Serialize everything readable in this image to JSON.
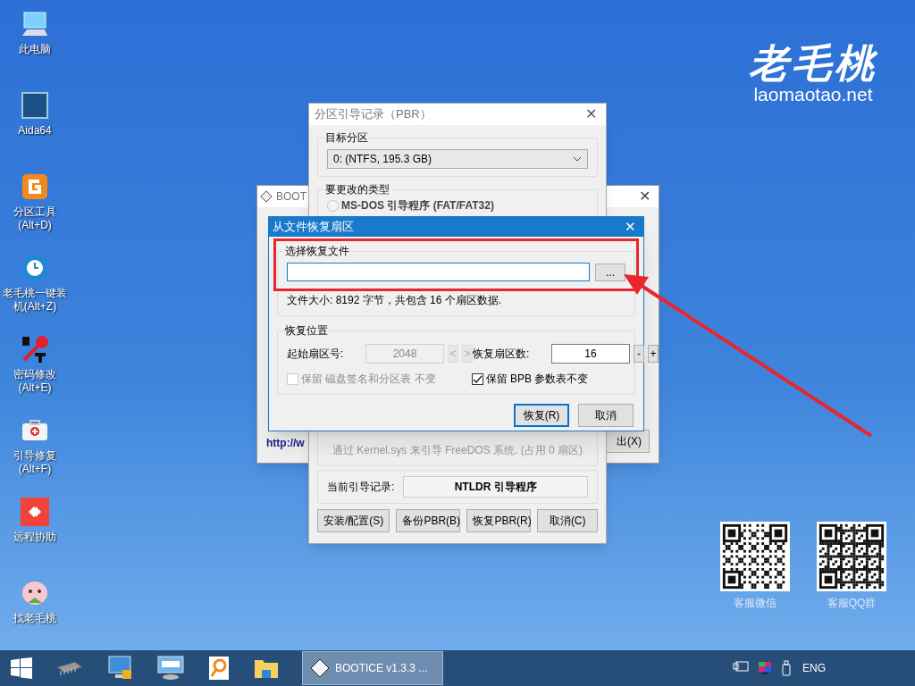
{
  "desktop_icons": [
    {
      "label": "此电脑",
      "kind": "pc"
    },
    {
      "label": "Aida64",
      "kind": "aida"
    },
    {
      "label": "分区工具 (Alt+D)",
      "kind": "partition"
    },
    {
      "label": "老毛桃一键装机(Alt+Z)",
      "kind": "restore"
    },
    {
      "label": "密码修改 (Alt+E)",
      "kind": "key"
    },
    {
      "label": "引导修复 (Alt+F)",
      "kind": "medkit"
    },
    {
      "label": "远程协助",
      "kind": "remote"
    },
    {
      "label": "找老毛桃",
      "kind": "mascot"
    }
  ],
  "logo": {
    "script": "老毛桃",
    "url": "laomaotao.net"
  },
  "qr_codes": [
    {
      "caption": "客服微信"
    },
    {
      "caption": "客服QQ群"
    }
  ],
  "bootice_window": {
    "title": "BOOT",
    "close": "✕",
    "link": "http://w",
    "button": "出(X)"
  },
  "pbr_window": {
    "title": "分区引导记录（PBR）",
    "close": "✕",
    "target_group": "目标分区",
    "partition": "0: (NTFS, 195.3 GB)",
    "type_group": "要更改的类型",
    "options": [
      {
        "label": "MS-DOS 引导程序 (FAT/FAT32)",
        "selected": false
      }
    ],
    "description": "通过 Kernel.sys 来引导 FreeDOS 系统. (占用 0 扇区)",
    "current_label": "当前引导记录:",
    "current_value": "NTLDR 引导程序",
    "buttons": [
      "安装/配置(S)",
      "备份PBR(B)",
      "恢复PBR(R)",
      "取消(C)"
    ]
  },
  "restore_dialog": {
    "title": "从文件恢复扇区",
    "close": "✕",
    "file_group": "选择恢复文件",
    "browse": "...",
    "file_info": "文件大小: 8192 字节，共包含 16 个扇区数据.",
    "position_group": "恢复位置",
    "start": {
      "label": "起始扇区号:",
      "value": "2048",
      "disabled": true,
      "steps": [
        "<",
        ">"
      ]
    },
    "count": {
      "label": "恢复扇区数:",
      "value": "16",
      "disabled": false,
      "steps": [
        "-",
        "+"
      ]
    },
    "checkboxes": [
      {
        "label": "保留 磁盘签名和分区表 不变",
        "checked": false,
        "disabled": true
      },
      {
        "label": "保留 BPB 参数表不变",
        "checked": true,
        "disabled": false
      }
    ],
    "buttons": [
      {
        "label": "恢复(R)",
        "default": true
      },
      {
        "label": "取消",
        "default": false
      }
    ]
  },
  "taskbar": {
    "pinned": [
      {
        "kind": "chip"
      },
      {
        "kind": "network"
      },
      {
        "kind": "keyboard"
      },
      {
        "kind": "search"
      },
      {
        "kind": "folder"
      }
    ],
    "task": {
      "label": "BOOTICE v1.3.3 ...",
      "selected": true
    },
    "language": "ENG"
  }
}
